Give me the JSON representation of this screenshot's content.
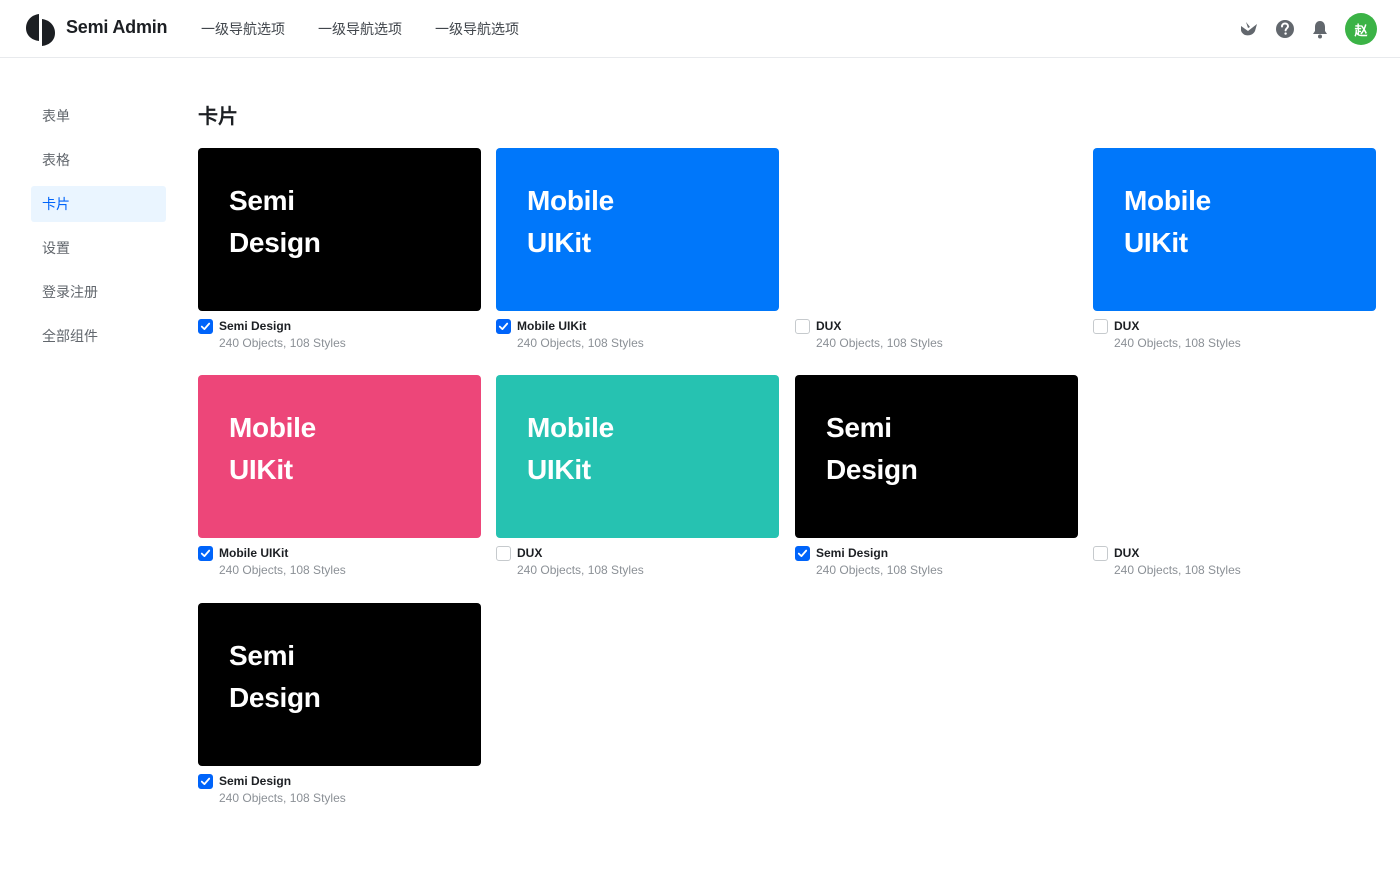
{
  "header": {
    "brand": "Semi Admin",
    "nav": [
      "一级导航选项",
      "一级导航选项",
      "一级导航选项"
    ],
    "avatar": "赵",
    "icons": [
      "semi-bird-icon",
      "help-icon",
      "bell-icon"
    ],
    "avatar_color": "#3bb346"
  },
  "sidebar": {
    "items": [
      {
        "label": "表单",
        "active": false
      },
      {
        "label": "表格",
        "active": false
      },
      {
        "label": "卡片",
        "active": true
      },
      {
        "label": "设置",
        "active": false
      },
      {
        "label": "登录注册",
        "active": false
      },
      {
        "label": "全部组件",
        "active": false
      }
    ]
  },
  "page": {
    "title": "卡片"
  },
  "cards": [
    {
      "cover_lines": [
        "Semi",
        "Design"
      ],
      "cover_color": "#000000",
      "title": "Semi Design",
      "subtitle": "240 Objects, 108 Styles",
      "checked": true
    },
    {
      "cover_lines": [
        "Mobile",
        "UIKit"
      ],
      "cover_color": "#0077fa",
      "title": "Mobile UIKit",
      "subtitle": "240 Objects, 108 Styles",
      "checked": true
    },
    {
      "cover_lines": [],
      "cover_color": "#ffffff",
      "title": "DUX",
      "subtitle": "240 Objects, 108 Styles",
      "checked": false
    },
    {
      "cover_lines": [
        "Mobile",
        "UIKit"
      ],
      "cover_color": "#0077fa",
      "title": "DUX",
      "subtitle": "240 Objects, 108 Styles",
      "checked": false
    },
    {
      "cover_lines": [
        "Mobile",
        "UIKit"
      ],
      "cover_color": "#ed4679",
      "title": "Mobile UIKit",
      "subtitle": "240 Objects, 108 Styles",
      "checked": true
    },
    {
      "cover_lines": [
        "Mobile",
        "UIKit"
      ],
      "cover_color": "#26c2b1",
      "title": "DUX",
      "subtitle": "240 Objects, 108 Styles",
      "checked": false
    },
    {
      "cover_lines": [
        "Semi",
        "Design"
      ],
      "cover_color": "#000000",
      "title": "Semi Design",
      "subtitle": "240 Objects, 108 Styles",
      "checked": true
    },
    {
      "cover_lines": [],
      "cover_color": "#ffffff",
      "title": "DUX",
      "subtitle": "240 Objects, 108 Styles",
      "checked": false
    },
    {
      "cover_lines": [
        "Semi",
        "Design"
      ],
      "cover_color": "#000000",
      "title": "Semi Design",
      "subtitle": "240 Objects, 108 Styles",
      "checked": true
    }
  ]
}
